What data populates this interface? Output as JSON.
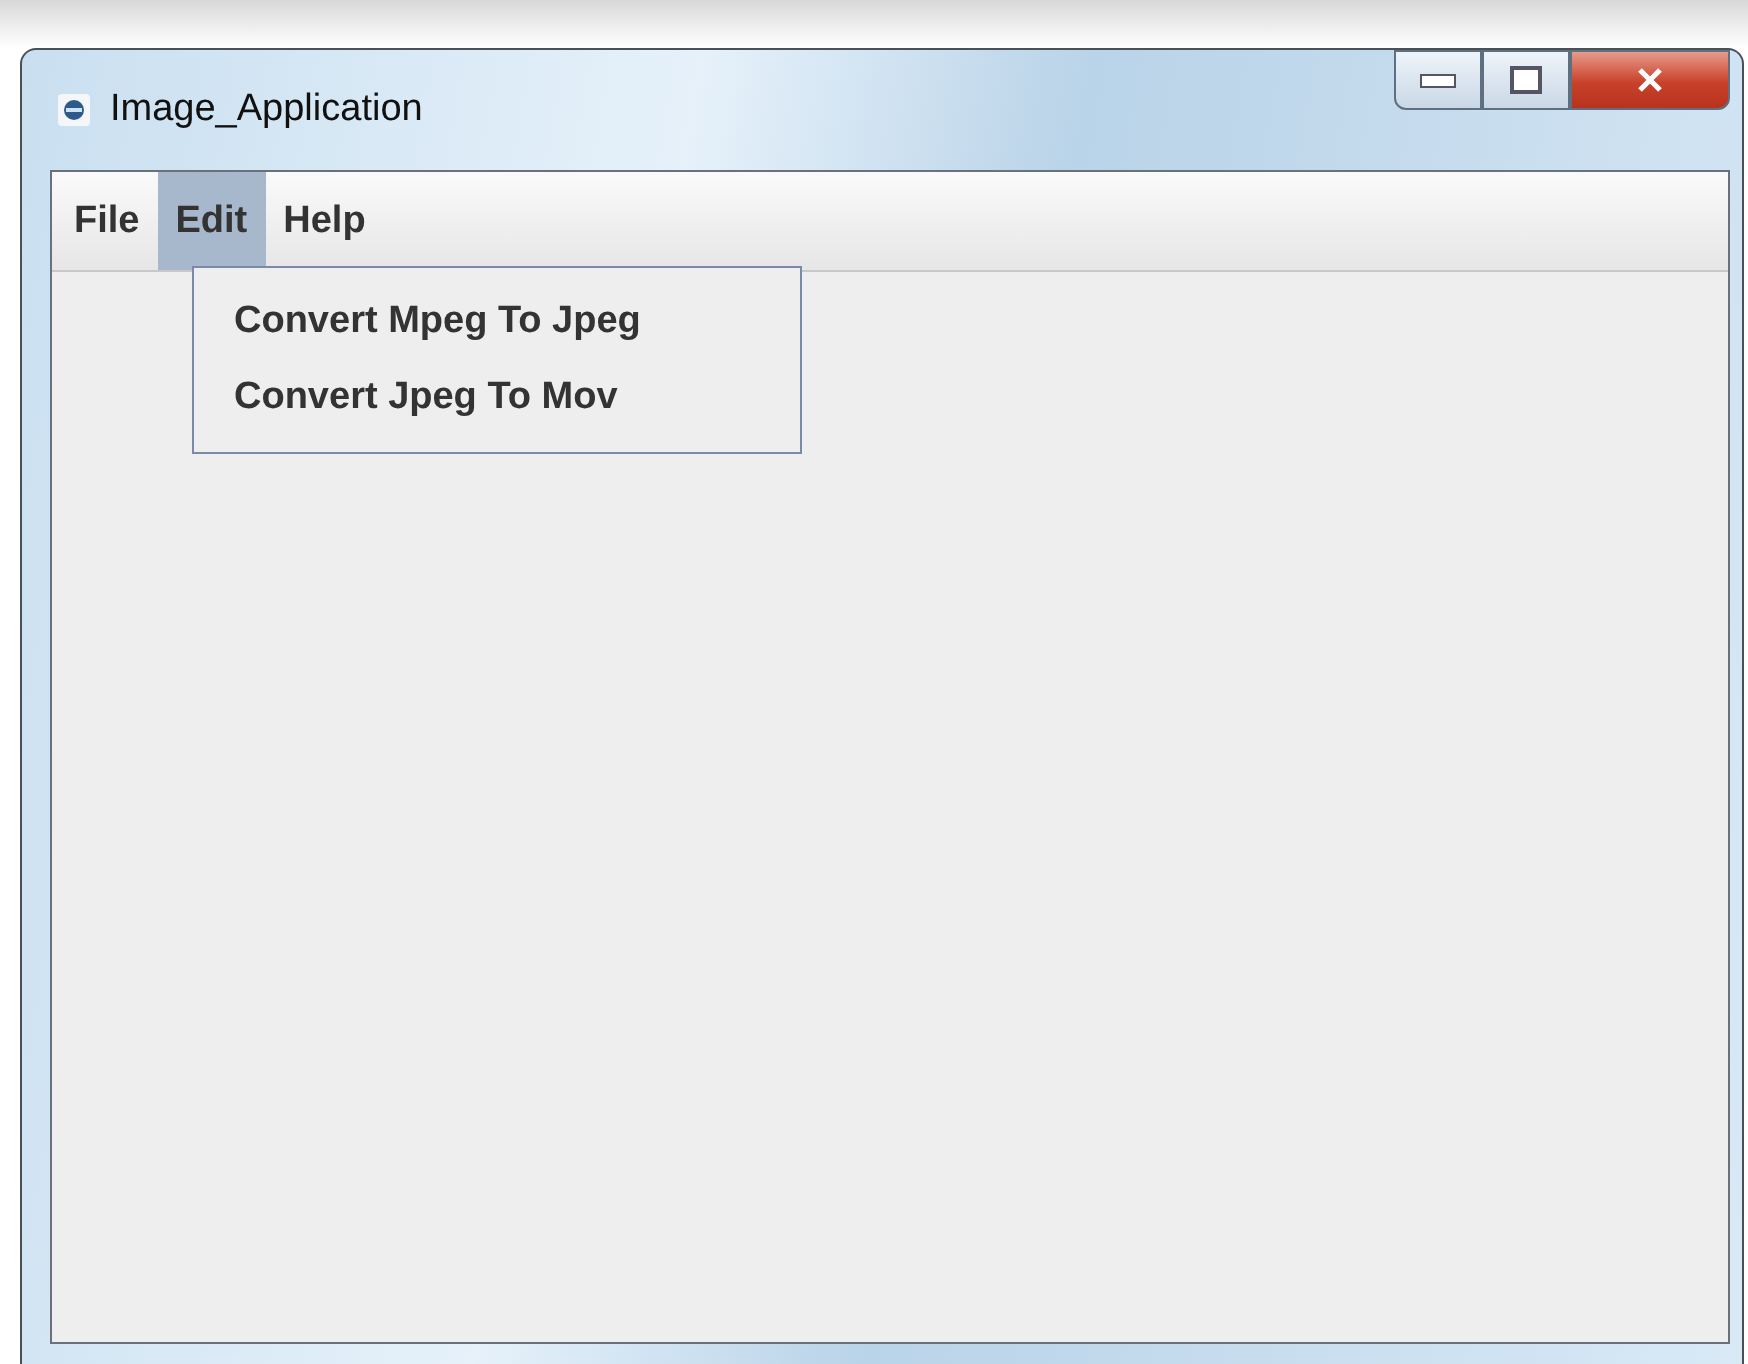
{
  "window": {
    "title": "Image_Application"
  },
  "menu_bar": [
    {
      "label": "File",
      "selected": false
    },
    {
      "label": "Edit",
      "selected": true
    },
    {
      "label": "Help",
      "selected": false
    }
  ],
  "open_menu": {
    "items": [
      "Convert Mpeg To Jpeg",
      "Convert Jpeg To Mov"
    ]
  }
}
